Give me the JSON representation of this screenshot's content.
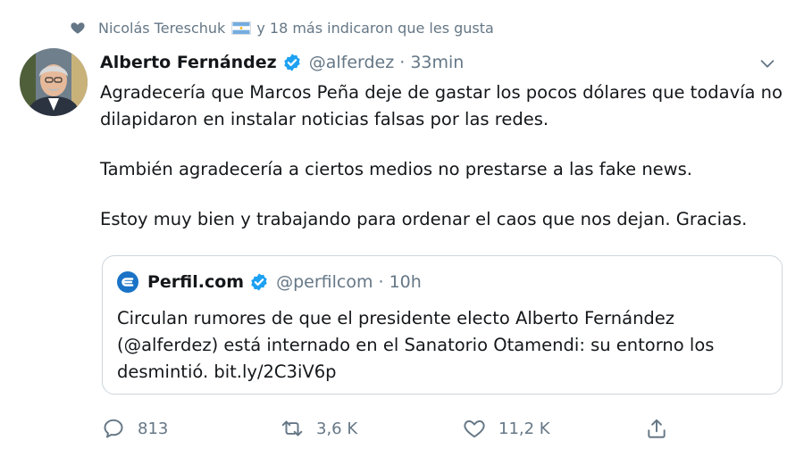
{
  "social_context": {
    "name": "Nicolás Tereschuk",
    "text": "y 18 más indicaron que les gusta"
  },
  "tweet": {
    "author_name": "Alberto Fernández",
    "handle": "@alferdez",
    "time": "· 33min",
    "paragraphs": [
      "Agradecería que Marcos Peña deje de gastar los pocos dólares que todavía no dilapidaron en instalar noticias falsas por las redes.",
      "También agradecería a ciertos medios no prestarse a las fake news.",
      "Estoy muy bien y trabajando para ordenar el caos que nos dejan. Gracias."
    ]
  },
  "quoted": {
    "author_name": "Perfil.com",
    "handle": "@perfilcom",
    "time": "· 10h",
    "text": "Circulan rumores de que el presidente electo Alberto Fernández (@alferdez) está internado en el Sanatorio Otamendi: su entorno los desmintió. bit.ly/2C3iV6p"
  },
  "actions": {
    "replies": "813",
    "retweets": "3,6 K",
    "likes": "11,2 K"
  },
  "colors": {
    "secondary_text": "#657786",
    "verified_blue": "#1da1f2",
    "border": "#ccd6dd",
    "perfil_blue": "#1a73c7"
  },
  "icons": [
    "heart-icon",
    "argentina-flag-icon",
    "verified-badge-icon",
    "chevron-down-icon",
    "perfil-logo-icon",
    "reply-icon",
    "retweet-icon",
    "like-icon",
    "share-icon"
  ]
}
